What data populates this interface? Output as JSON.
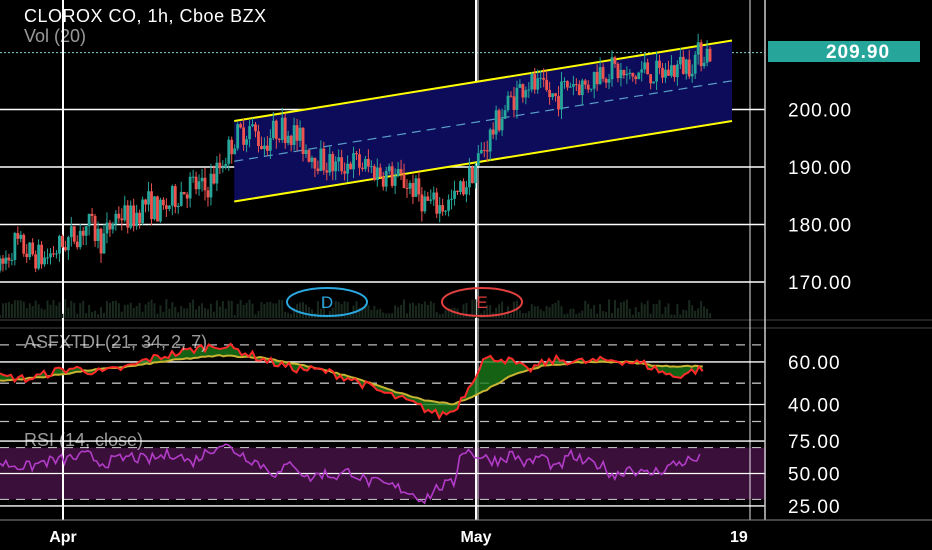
{
  "colors": {
    "background": "#000000",
    "gridline": "#ffffff",
    "up_candle": "#26a69a",
    "down_candle": "#ef5350",
    "channel_line": "#ffff00",
    "channel_fill": "#0c0c5a",
    "channel_mid": "#5aa0c8",
    "price_badge": "#26a69a",
    "osc_fast": "#ff2a2a",
    "osc_slow": "#c8b432",
    "osc_fill": "#1a7a1a",
    "rsi_line": "#b23cc8",
    "rsi_band": "#3a0f3a",
    "marker_d": "#2aa8e0",
    "marker_e": "#e04040"
  },
  "header": {
    "symbol_title": "CLOROX CO, 1h, Cboe BZX",
    "volume_legend": "Vol (20)"
  },
  "markers": [
    {
      "label": "D",
      "color_key": "marker_d"
    },
    {
      "label": "E",
      "color_key": "marker_e"
    }
  ],
  "chart_data": [
    {
      "type": "candlestick",
      "title": "CLOROX CO, 1h, Cboe BZX",
      "y_axis_ticks": [
        "200.00",
        "190.00",
        "180.00",
        "170.00"
      ],
      "ylim": [
        163,
        215
      ],
      "grid": true,
      "last_price": "209.90",
      "x_axis_ticks": [
        "Apr",
        "May",
        "19"
      ],
      "x_range_sessions": [
        0,
        100
      ],
      "channel": {
        "upper_start": [
          32,
          198
        ],
        "upper_end": [
          100,
          212
        ],
        "lower_start": [
          32,
          184
        ],
        "lower_end": [
          100,
          198
        ],
        "box_range_sessions": [
          32,
          100
        ]
      },
      "close_anchors": [
        [
          0,
          172
        ],
        [
          2,
          177
        ],
        [
          4,
          175
        ],
        [
          6,
          174
        ],
        [
          8,
          176
        ],
        [
          10,
          178
        ],
        [
          12,
          180
        ],
        [
          14,
          177
        ],
        [
          16,
          182
        ],
        [
          18,
          181
        ],
        [
          20,
          184
        ],
        [
          22,
          182
        ],
        [
          24,
          185
        ],
        [
          26,
          187
        ],
        [
          28,
          186
        ],
        [
          30,
          190
        ],
        [
          32,
          195
        ],
        [
          34,
          197
        ],
        [
          36,
          194
        ],
        [
          38,
          197
        ],
        [
          40,
          196
        ],
        [
          42,
          193
        ],
        [
          44,
          191
        ],
        [
          46,
          190
        ],
        [
          48,
          191
        ],
        [
          50,
          190
        ],
        [
          52,
          189
        ],
        [
          54,
          188
        ],
        [
          56,
          187
        ],
        [
          58,
          184
        ],
        [
          60,
          183
        ],
        [
          62,
          184
        ],
        [
          64,
          188
        ],
        [
          66,
          193
        ],
        [
          68,
          198
        ],
        [
          70,
          202
        ],
        [
          72,
          205
        ],
        [
          74,
          203
        ],
        [
          76,
          202
        ],
        [
          78,
          205
        ],
        [
          80,
          204
        ],
        [
          82,
          207
        ],
        [
          84,
          207
        ],
        [
          86,
          205
        ],
        [
          88,
          207
        ],
        [
          90,
          206
        ],
        [
          92,
          207
        ],
        [
          94,
          208
        ],
        [
          96,
          210
        ]
      ]
    },
    {
      "type": "line",
      "title": "ASFXTDI (21, 34, 2, 7)",
      "y_axis_ticks": [
        "60.00",
        "40.00"
      ],
      "ylim": [
        28,
        75
      ],
      "series": [
        {
          "color_key": "osc_fast",
          "anchors": [
            [
              0,
              53
            ],
            [
              4,
              52
            ],
            [
              8,
              56
            ],
            [
              10,
              57
            ],
            [
              14,
              55
            ],
            [
              18,
              58
            ],
            [
              20,
              61
            ],
            [
              24,
              64
            ],
            [
              28,
              67
            ],
            [
              30,
              68
            ],
            [
              33,
              65
            ],
            [
              36,
              61
            ],
            [
              40,
              57
            ],
            [
              44,
              56
            ],
            [
              48,
              52
            ],
            [
              52,
              46
            ],
            [
              56,
              41
            ],
            [
              58,
              38
            ],
            [
              60,
              35
            ],
            [
              62,
              37
            ],
            [
              64,
              48
            ],
            [
              66,
              61
            ],
            [
              68,
              62
            ],
            [
              70,
              60
            ],
            [
              72,
              56
            ],
            [
              74,
              59
            ],
            [
              76,
              61
            ],
            [
              80,
              60
            ],
            [
              84,
              61
            ],
            [
              88,
              59
            ],
            [
              90,
              56
            ],
            [
              92,
              53
            ],
            [
              94,
              55
            ],
            [
              96,
              57
            ]
          ]
        },
        {
          "color_key": "osc_slow",
          "anchors": [
            [
              0,
              51
            ],
            [
              6,
              53
            ],
            [
              12,
              56
            ],
            [
              18,
              58
            ],
            [
              24,
              61
            ],
            [
              30,
              63
            ],
            [
              36,
              62
            ],
            [
              42,
              58
            ],
            [
              48,
              53
            ],
            [
              54,
              46
            ],
            [
              58,
              42
            ],
            [
              62,
              40
            ],
            [
              66,
              46
            ],
            [
              70,
              54
            ],
            [
              74,
              58
            ],
            [
              80,
              60
            ],
            [
              86,
              60
            ],
            [
              90,
              58
            ],
            [
              96,
              58
            ]
          ]
        }
      ]
    },
    {
      "type": "line",
      "title": "RSI (14, close)",
      "y_axis_ticks": [
        "75.00",
        "50.00",
        "25.00"
      ],
      "ylim": [
        18,
        82
      ],
      "band": [
        30,
        70
      ],
      "series": [
        {
          "color_key": "rsi_line",
          "anchors": [
            [
              0,
              58
            ],
            [
              4,
              55
            ],
            [
              6,
              59
            ],
            [
              8,
              60
            ],
            [
              12,
              64
            ],
            [
              14,
              58
            ],
            [
              18,
              63
            ],
            [
              20,
              60
            ],
            [
              24,
              66
            ],
            [
              26,
              58
            ],
            [
              30,
              73
            ],
            [
              32,
              68
            ],
            [
              35,
              59
            ],
            [
              38,
              49
            ],
            [
              40,
              59
            ],
            [
              42,
              46
            ],
            [
              44,
              50
            ],
            [
              46,
              48
            ],
            [
              48,
              52
            ],
            [
              50,
              44
            ],
            [
              52,
              42
            ],
            [
              55,
              38
            ],
            [
              58,
              30
            ],
            [
              60,
              40
            ],
            [
              62,
              42
            ],
            [
              63,
              69
            ],
            [
              64,
              67
            ],
            [
              66,
              62
            ],
            [
              68,
              60
            ],
            [
              70,
              65
            ],
            [
              72,
              57
            ],
            [
              74,
              64
            ],
            [
              76,
              53
            ],
            [
              78,
              64
            ],
            [
              80,
              58
            ],
            [
              82,
              57
            ],
            [
              84,
              48
            ],
            [
              86,
              55
            ],
            [
              88,
              49
            ],
            [
              90,
              52
            ],
            [
              92,
              57
            ],
            [
              94,
              60
            ],
            [
              96,
              61
            ]
          ]
        }
      ]
    }
  ]
}
